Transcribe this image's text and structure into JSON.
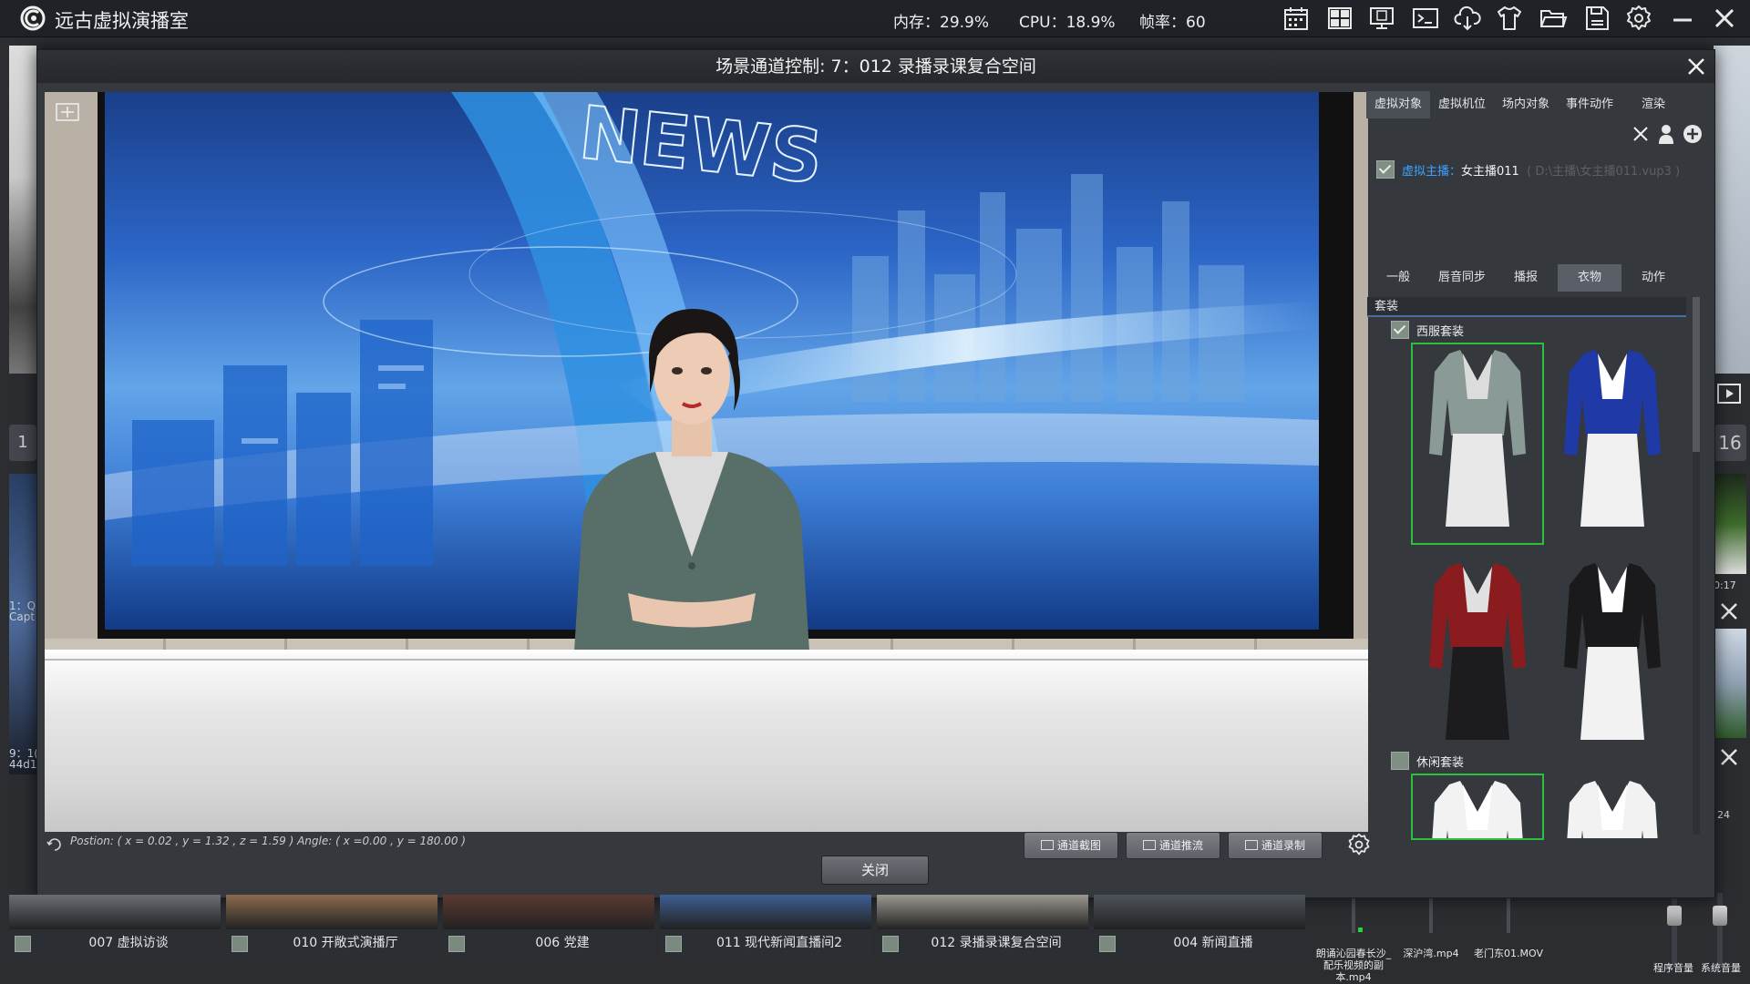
{
  "app": {
    "title": "远古虚拟演播室",
    "stats": {
      "memory": "内存：29.9%",
      "cpu": "CPU：18.9%",
      "fps": "帧率：60"
    }
  },
  "toolbar_icons": [
    "calendar-icon",
    "layout-icon",
    "monitor-icon",
    "terminal-icon",
    "cloud-download-icon",
    "shirt-icon",
    "folder-icon",
    "save-icon",
    "gear-icon",
    "minimize-icon",
    "close-icon"
  ],
  "background": {
    "left_labels": [
      "1：Q",
      "Capt",
      "9：1(",
      "44d1("
    ],
    "left_number": "1",
    "right_number": "16",
    "right_labels": [
      "0:17",
      "24"
    ]
  },
  "scenes": [
    {
      "label": "007 虚拟访谈",
      "color": "#6a6e74"
    },
    {
      "label": "010 开敞式演播厅",
      "color": "#8b6b4f"
    },
    {
      "label": "006 党建",
      "color": "#5b3a32"
    },
    {
      "label": "011 现代新闻直播间2",
      "color": "#3d5f93"
    },
    {
      "label": "012 录播录课复合空间",
      "color": "#9a9890"
    },
    {
      "label": "004 新闻直播",
      "color": "#4d535b"
    }
  ],
  "audio": {
    "clips": [
      "朗诵沁园春长沙_配乐视频的副本.mp4",
      "深沪湾.mp4",
      "老门东01.MOV"
    ],
    "volumes": [
      "程序音量",
      "系统音量"
    ]
  },
  "dialog": {
    "title": "场景通道控制: 7：012 录播录课复合空间",
    "position_text": "Postion: ( x = 0.02 , y = 1.32 , z = 1.59 )  Angle: ( x =0.00 , y = 180.00 )",
    "buttons": {
      "snapshot": "通道截图",
      "stream": "通道推流",
      "record": "通道录制",
      "close": "关闭"
    },
    "screen_text": "NEWS"
  },
  "panel": {
    "tabs": [
      "虚拟对象",
      "虚拟机位",
      "场内对象",
      "事件动作",
      "渲染"
    ],
    "active_tab": 0,
    "object": {
      "label": "虚拟主播：",
      "name": "女主播011",
      "path": "( D:\\主播\\女主播011.vup3 )"
    },
    "subtabs": [
      "一般",
      "唇音同步",
      "播报",
      "衣物",
      "动作"
    ],
    "active_subtab": 3,
    "section": "套装",
    "groups": [
      {
        "name": "西服套装",
        "checked": true,
        "outfits": [
          {
            "top": "#8a9a96",
            "bottom": "#e8e8e8",
            "inner": "#dcdcdc",
            "selected": true
          },
          {
            "top": "#1f3aa6",
            "bottom": "#f0f0f0",
            "inner": "#ffffff",
            "selected": false
          },
          {
            "top": "#8a1c1f",
            "bottom": "#1c1c1e",
            "inner": "#e0e0e0",
            "selected": false
          },
          {
            "top": "#1a1a1c",
            "bottom": "#f2f2f2",
            "inner": "#ffffff",
            "selected": false
          }
        ]
      },
      {
        "name": "休闲套装",
        "checked": false,
        "outfits": [
          {
            "top": "#f2f2f2",
            "bottom": "#3aa7a0",
            "inner": "#ffffff",
            "selected": true
          },
          {
            "top": "#f2f2f2",
            "bottom": "#3a76b5",
            "inner": "#ffffff",
            "selected": false
          }
        ]
      }
    ]
  }
}
